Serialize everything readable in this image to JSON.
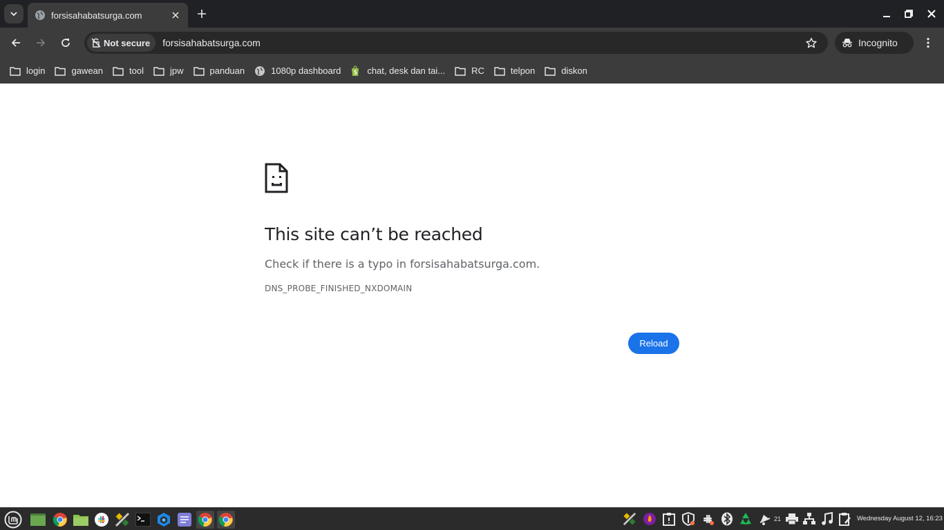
{
  "tab": {
    "title": "forsisahabatsurga.com"
  },
  "toolbar": {
    "security_chip": "Not secure",
    "url": "forsisahabatsurga.com",
    "incognito_label": "Incognito"
  },
  "bookmarks": [
    {
      "label": "login",
      "icon": "folder-icon"
    },
    {
      "label": "gawean",
      "icon": "folder-icon"
    },
    {
      "label": "tool",
      "icon": "folder-icon"
    },
    {
      "label": "jpw",
      "icon": "folder-icon"
    },
    {
      "label": "panduan",
      "icon": "folder-icon"
    },
    {
      "label": "1080p dashboard",
      "icon": "globe-icon"
    },
    {
      "label": "chat, desk dan tai...",
      "icon": "shopify-icon"
    },
    {
      "label": "RC",
      "icon": "folder-icon"
    },
    {
      "label": "telpon",
      "icon": "folder-icon"
    },
    {
      "label": "diskon",
      "icon": "folder-icon"
    }
  ],
  "error": {
    "title": "This site can’t be reached",
    "description": "Check if there is a typo in forsisahabatsurga.com.",
    "code": "DNS_PROBE_FINISHED_NXDOMAIN",
    "reload_label": "Reload"
  },
  "taskbar": {
    "tray_badge": "21",
    "clock": "Wednesday August 12, 16:23"
  },
  "colors": {
    "tab_strip": "#202124",
    "toolbar": "#3c3c3c",
    "accent": "#1a73e8",
    "taskbar": "#2b2b2b"
  }
}
